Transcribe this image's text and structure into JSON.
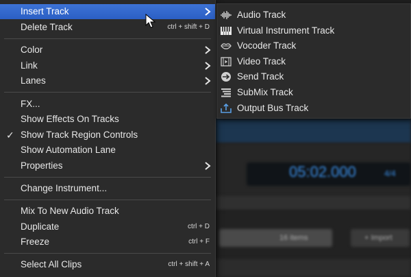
{
  "context_menu": {
    "items": [
      {
        "label": "Insert Track",
        "shortcut": "",
        "submenu": true,
        "highlighted": true
      },
      {
        "label": "Delete Track",
        "shortcut": "ctrl + shift + D"
      },
      {
        "label": "Color",
        "submenu": true
      },
      {
        "label": "Link",
        "submenu": true
      },
      {
        "label": "Lanes",
        "submenu": true
      },
      {
        "label": "FX..."
      },
      {
        "label": "Show Effects On Tracks"
      },
      {
        "label": "Show Track Region Controls",
        "checked": true
      },
      {
        "label": "Show Automation Lane"
      },
      {
        "label": "Properties",
        "submenu": true
      },
      {
        "label": "Change Instrument..."
      },
      {
        "label": "Mix To New Audio Track"
      },
      {
        "label": "Duplicate",
        "shortcut": "ctrl + D"
      },
      {
        "label": "Freeze",
        "shortcut": "ctrl + F"
      },
      {
        "label": "Select All Clips",
        "shortcut": "ctrl + shift + A"
      }
    ],
    "checkmark": "✓"
  },
  "insert_track_submenu": {
    "items": [
      {
        "label": "Audio Track",
        "icon": "waveform-icon"
      },
      {
        "label": "Virtual Instrument Track",
        "icon": "piano-keys-icon"
      },
      {
        "label": "Vocoder Track",
        "icon": "lips-icon"
      },
      {
        "label": "Video Track",
        "icon": "film-icon"
      },
      {
        "label": "Send Track",
        "icon": "send-arrow-icon"
      },
      {
        "label": "SubMix Track",
        "icon": "submix-icon"
      },
      {
        "label": "Output Bus Track",
        "icon": "output-bus-icon"
      }
    ]
  },
  "background": {
    "time_display": "05:02.000",
    "time_signature": "4/4",
    "search_count": "16 items",
    "import_button": "+ Import"
  },
  "colors": {
    "highlight": "#2b5fc4",
    "menu_bg": "#2b2b2b",
    "time_display": "#3a8ee6"
  }
}
